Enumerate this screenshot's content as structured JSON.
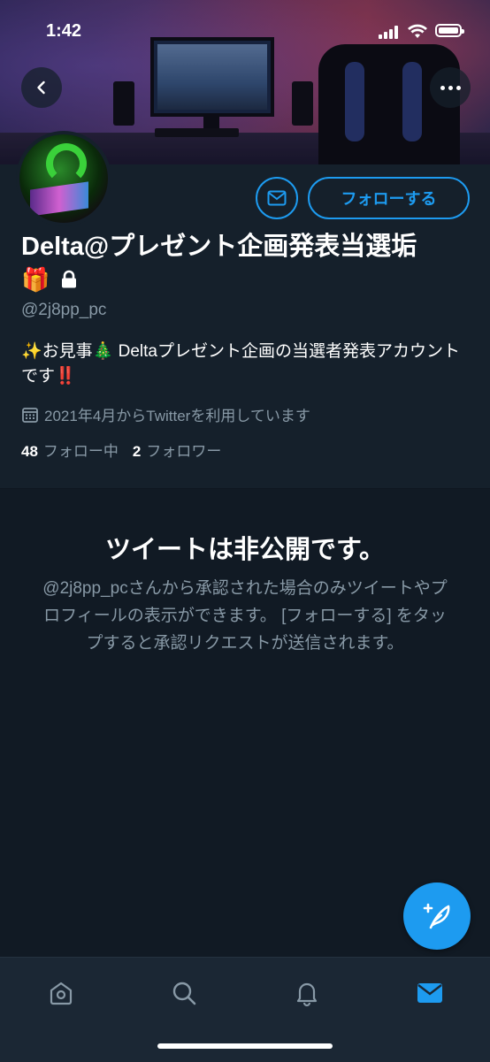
{
  "status_bar": {
    "time": "1:42"
  },
  "profile": {
    "display_name": "Delta@プレゼント企画発表当選垢",
    "name_emoji": "🎁",
    "handle": "@2j8pp_pc",
    "bio": "✨お見事🎄 Deltaプレゼント企画の当選者発表アカウントです‼️",
    "joined": "2021年4月からTwitterを利用しています",
    "following_count": "48",
    "following_label": "フォロー中",
    "followers_count": "2",
    "followers_label": "フォロワー"
  },
  "actions": {
    "follow_label": "フォローする"
  },
  "protected": {
    "title": "ツイートは非公開です。",
    "description": "@2j8pp_pcさんから承認された場合のみツイートやプロフィールの表示ができます。 [フォローする] をタップすると承認リクエストが送信されます。"
  },
  "icons": {
    "back": "chevron-left-icon",
    "more": "more-dots-icon",
    "message": "envelope-icon",
    "lock": "lock-icon",
    "calendar": "calendar-icon",
    "compose": "compose-feather-icon",
    "tabs": [
      "home-icon",
      "search-icon",
      "bell-icon",
      "envelope-icon"
    ]
  },
  "colors": {
    "accent": "#1d9bf0",
    "background": "#15202b",
    "secondary_text": "#8899a6"
  }
}
